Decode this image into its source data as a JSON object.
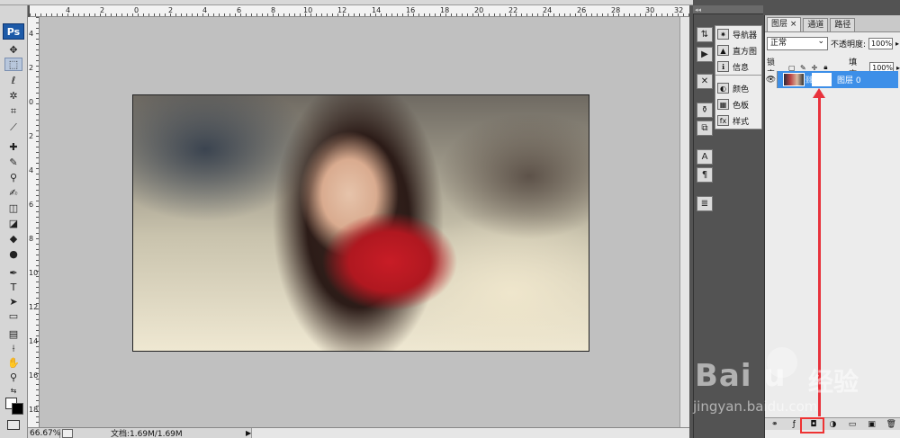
{
  "app": {
    "logo": "Ps"
  },
  "ruler_top_ticks": [
    "4",
    "2",
    "0",
    "2",
    "4",
    "6",
    "8",
    "10",
    "12",
    "14",
    "16",
    "18",
    "20",
    "22",
    "24",
    "26",
    "28",
    "30",
    "32"
  ],
  "ruler_left_ticks": [
    "4",
    "2",
    "0",
    "2",
    "4",
    "6",
    "8",
    "10",
    "12",
    "14",
    "16",
    "18"
  ],
  "status": {
    "zoom": "66.67%",
    "doc": "文档:1.69M/1.69M",
    "arrow": "▶"
  },
  "panel2": {
    "items": [
      {
        "icon": "navigator-icon",
        "label": "导航器"
      },
      {
        "icon": "histogram-icon",
        "label": "直方图"
      },
      {
        "icon": "info-icon",
        "label": "信息"
      },
      {
        "icon": "color-icon",
        "label": "颜色"
      },
      {
        "icon": "swatches-icon",
        "label": "色板"
      },
      {
        "icon": "styles-icon",
        "label": "样式"
      }
    ]
  },
  "layers": {
    "tabs": [
      "图层 ×",
      "通道",
      "路径"
    ],
    "blend_mode": "正常",
    "opacity_label": "不透明度:",
    "opacity_value": "100%",
    "lock_label": "锁定:",
    "fill_label": "填充:",
    "fill_value": "100%",
    "layer_name": "图层 0"
  },
  "watermark": {
    "brand": "Bai  u",
    "cn": "经验",
    "url": "jingyan.baidu.com"
  },
  "colors": {
    "accent": "#3d8fe8",
    "arrow": "#e8323c"
  }
}
